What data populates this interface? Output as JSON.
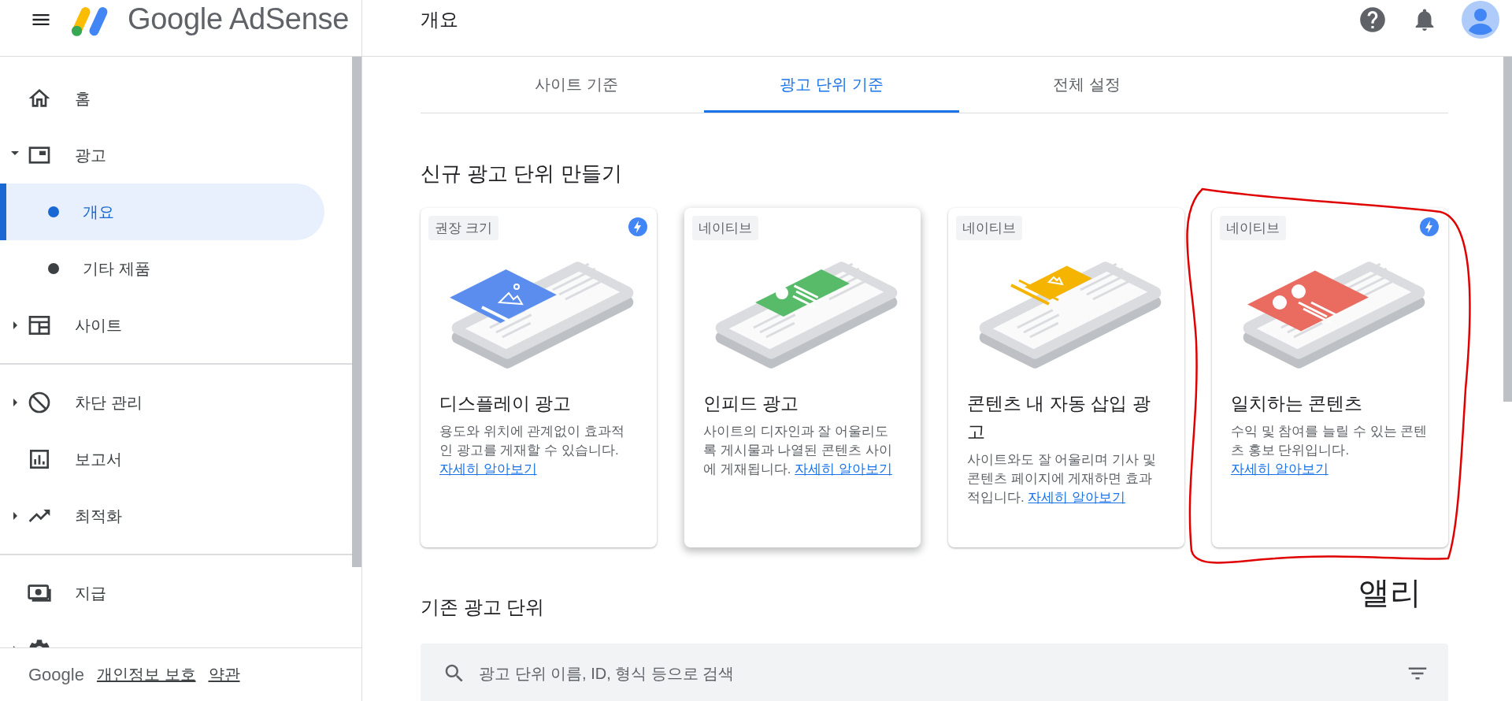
{
  "header": {
    "brand": "Google AdSense",
    "title": "개요"
  },
  "sidebar": {
    "sections": [
      {
        "items": [
          {
            "label": "홈",
            "expandable": false,
            "selected": false
          },
          {
            "label": "광고",
            "expandable": true,
            "expanded": true,
            "selected": false,
            "children": [
              {
                "label": "개요",
                "selected": true
              },
              {
                "label": "기타 제품",
                "selected": false
              }
            ]
          },
          {
            "label": "사이트",
            "expandable": true,
            "expanded": false,
            "selected": false
          }
        ]
      },
      {
        "items": [
          {
            "label": "차단 관리",
            "expandable": true,
            "expanded": false,
            "selected": false
          },
          {
            "label": "보고서",
            "expandable": false,
            "selected": false
          },
          {
            "label": "최적화",
            "expandable": true,
            "expanded": false,
            "selected": false
          }
        ]
      },
      {
        "items": [
          {
            "label": "지급",
            "expandable": false,
            "selected": false
          },
          {
            "expandable": true,
            "expanded": false,
            "selected": false
          }
        ]
      }
    ],
    "footer": {
      "brand": "Google",
      "links": [
        "개인정보 보호",
        "약관"
      ]
    }
  },
  "tabs": [
    {
      "label": "사이트 기준",
      "selected": false
    },
    {
      "label": "광고 단위 기준",
      "selected": true
    },
    {
      "label": "전체 설정",
      "selected": false
    }
  ],
  "create_section": {
    "title": "신규 광고 단위 만들기",
    "cards": [
      {
        "kind": "display",
        "chip": "권장 크기",
        "lightning": true,
        "hovered": false,
        "circled": false,
        "title": "디스플레이 광고",
        "description": "용도와 위치에 관계없이 효과적인 광고를 게재할 수 있습니다. ",
        "link": "자세히 알아보기"
      },
      {
        "kind": "infeed",
        "chip": "네이티브",
        "lightning": false,
        "hovered": true,
        "circled": false,
        "title": "인피드 광고",
        "description": "사이트의 디자인과 잘 어울리도록 게시물과 나열된 콘텐츠 사이에 게재됩니다. ",
        "link": "자세히 알아보기"
      },
      {
        "kind": "inarticle",
        "chip": "네이티브",
        "lightning": false,
        "hovered": false,
        "circled": false,
        "title": "콘텐츠 내 자동 삽입 광고",
        "description": "사이트와도 잘 어울리며 기사 및 콘텐츠 페이지에 게재하면 효과적입니다. ",
        "link": "자세히 알아보기"
      },
      {
        "kind": "matched",
        "chip": "네이티브",
        "lightning": true,
        "hovered": false,
        "circled": true,
        "title": "일치하는 콘텐츠",
        "description": "수익 및 참여를 늘릴 수 있는 콘텐츠 홍보 단위입니다. ",
        "link": "자세히 알아보기"
      }
    ]
  },
  "existing_section": {
    "title": "기존 광고 단위",
    "search": {
      "placeholder": "광고 단위 이름, ID, 형식 등으로 검색"
    }
  },
  "annotation": {
    "signature": "앨리"
  }
}
